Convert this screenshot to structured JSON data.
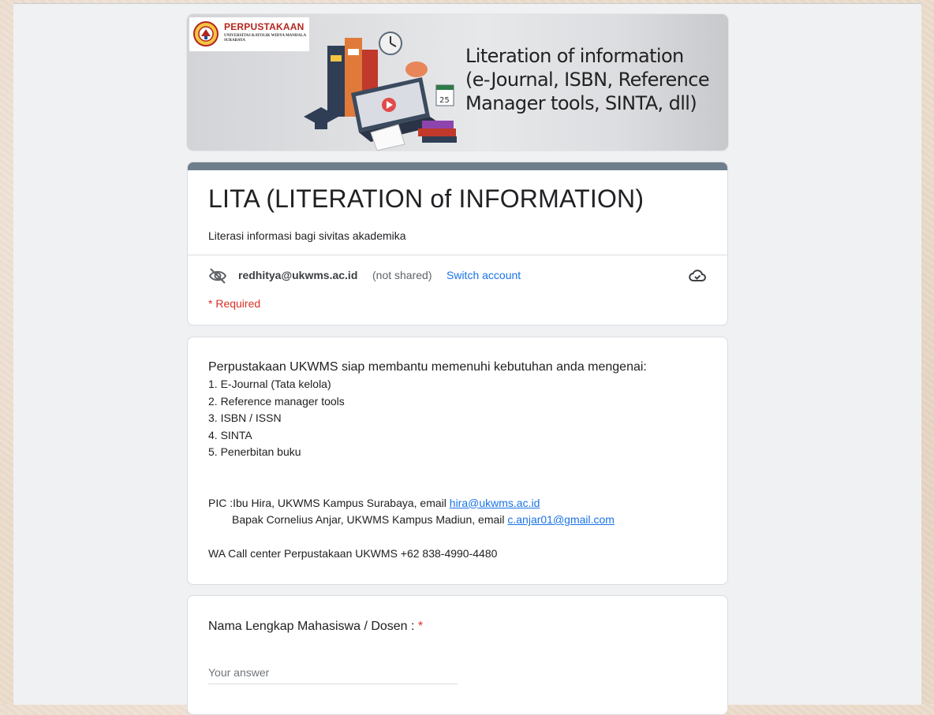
{
  "banner": {
    "logo_title": "PERPUSTAKAAN",
    "logo_subtitle": "UNIVERSITAS KATOLIK WIDYA MANDALA SURABAYA",
    "headline": "Literation of information\n(e-Journal, ISBN, Reference\nManager tools, SINTA, dll)",
    "calendar_day": "25"
  },
  "form": {
    "title": "LITA (LITERATION of INFORMATION)",
    "description": "Literasi informasi bagi sivitas akademika"
  },
  "account": {
    "email": "redhitya@ukwms.ac.id",
    "not_shared": "(not shared)",
    "switch_label": "Switch account",
    "required_note": "* Required"
  },
  "info": {
    "heading": "Perpustakaan UKWMS siap membantu memenuhi kebutuhan anda mengenai:",
    "items": [
      "1. E-Journal (Tata kelola)",
      "2. Reference manager tools",
      "3. ISBN / ISSN",
      "4. SINTA",
      "5. Penerbitan buku"
    ],
    "pic1_prefix": "PIC :Ibu Hira, UKWMS Kampus Surabaya, email ",
    "pic1_email": "hira@ukwms.ac.id",
    "pic2_prefix": "Bapak Cornelius Anjar, UKWMS Kampus Madiun, email ",
    "pic2_email": "c.anjar01@gmail.com",
    "wa": "WA Call center Perpustakaan UKWMS +62 838-4990-4480"
  },
  "question": {
    "label": "Nama Lengkap Mahasiswa / Dosen :",
    "required_mark": "*",
    "placeholder": "Your answer",
    "value": ""
  },
  "colors": {
    "accent": "#6e7e8c",
    "link": "#1a73e8",
    "required": "#d93025"
  }
}
